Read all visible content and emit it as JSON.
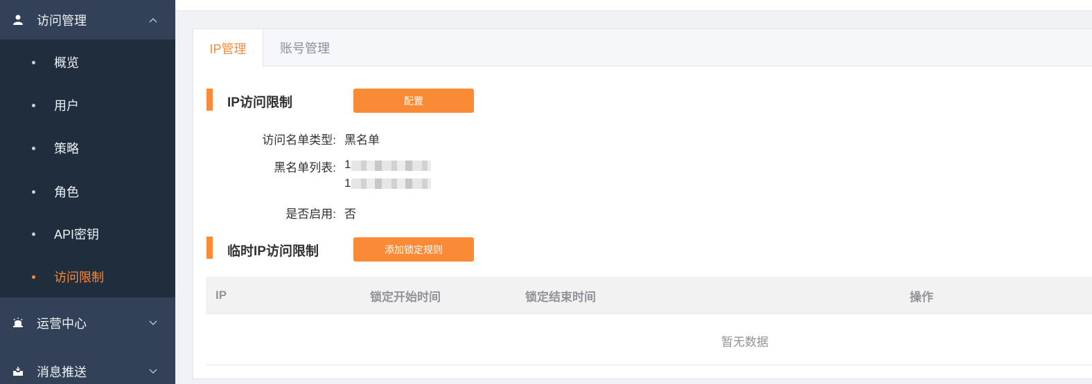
{
  "sidebar": {
    "access_menu": {
      "label": "访问管理",
      "icon": "user-icon",
      "expanded": true
    },
    "items": [
      {
        "label": "概览"
      },
      {
        "label": "用户"
      },
      {
        "label": "策略"
      },
      {
        "label": "角色"
      },
      {
        "label": "API密钥"
      },
      {
        "label": "访问限制",
        "active": true
      }
    ],
    "ops_menu": {
      "label": "运营中心",
      "icon": "alarm-icon"
    },
    "push_menu": {
      "label": "消息推送",
      "icon": "inbox-icon"
    }
  },
  "tabs": [
    {
      "label": "IP管理",
      "active": true
    },
    {
      "label": "账号管理"
    }
  ],
  "ip_restriction": {
    "title": "IP访问限制",
    "config_button": "配置",
    "list_type_label": "访问名单类型:",
    "list_type_value": "黑名单",
    "blacklist_label": "黑名单列表:",
    "blacklist_entries": [
      "1",
      "1"
    ],
    "enabled_label": "是否启用:",
    "enabled_value": "否"
  },
  "temp_restriction": {
    "title": "临时IP访问限制",
    "add_button": "添加锁定规则",
    "columns": [
      "IP",
      "锁定开始时间",
      "锁定结束时间",
      "操作"
    ],
    "empty_text": "暂无数据"
  },
  "colors": {
    "accent": "#fb8a37",
    "sidebar_bg": "#324157",
    "submenu_bg": "#1f2d3d"
  }
}
